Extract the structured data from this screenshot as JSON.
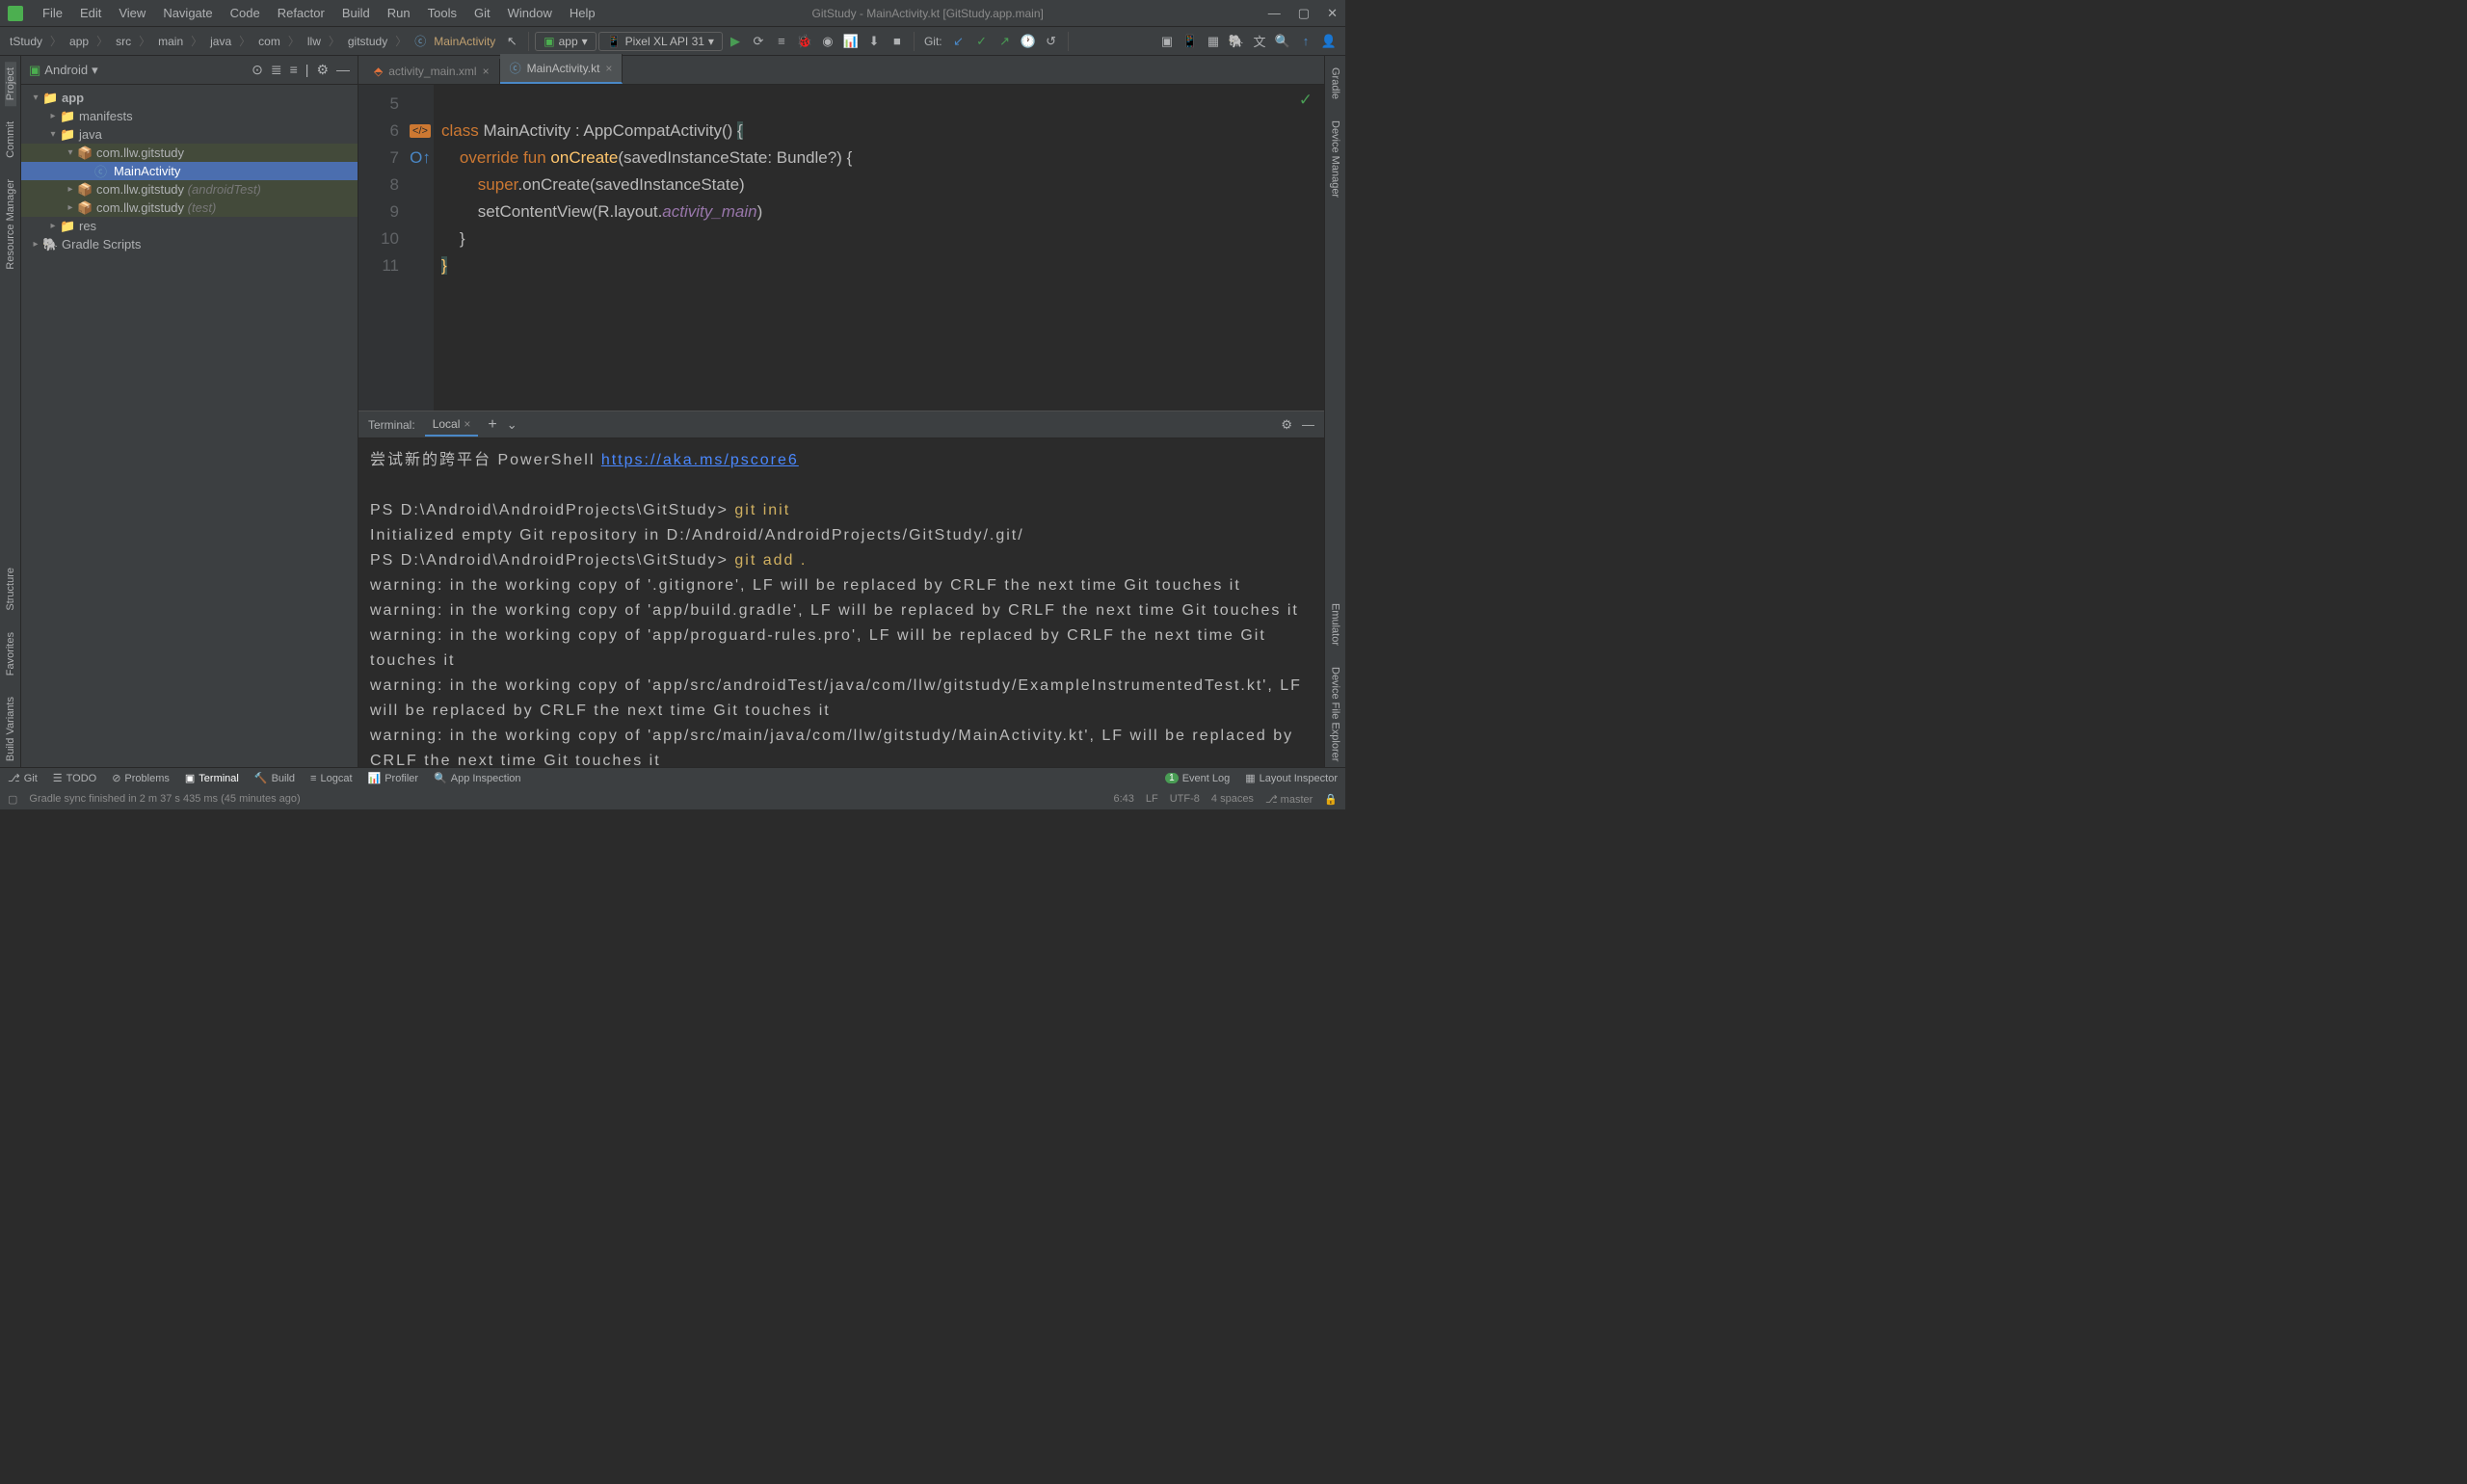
{
  "window": {
    "title": "GitStudy - MainActivity.kt [GitStudy.app.main]"
  },
  "menu": [
    "File",
    "Edit",
    "View",
    "Navigate",
    "Code",
    "Refactor",
    "Build",
    "Run",
    "Tools",
    "Git",
    "Window",
    "Help"
  ],
  "breadcrumb": [
    "tStudy",
    "app",
    "src",
    "main",
    "java",
    "com",
    "llw",
    "gitstudy"
  ],
  "breadcrumb_last": "MainActivity",
  "toolbar": {
    "config": "app",
    "device": "Pixel XL API 31",
    "git_label": "Git:"
  },
  "project": {
    "header": "Android",
    "tree": {
      "app": "app",
      "manifests": "manifests",
      "java": "java",
      "pkg_main": "com.llw.gitstudy",
      "main_activity": "MainActivity",
      "pkg_android_test": "com.llw.gitstudy",
      "pkg_android_test_suffix": "(androidTest)",
      "pkg_test": "com.llw.gitstudy",
      "pkg_test_suffix": "(test)",
      "res": "res",
      "gradle": "Gradle Scripts"
    }
  },
  "tabs": {
    "xml": "activity_main.xml",
    "kt": "MainActivity.kt"
  },
  "editor": {
    "line_numbers": [
      "5",
      "6",
      "7",
      "8",
      "9",
      "10",
      "11"
    ],
    "lines": [
      "",
      "class MainActivity : AppCompatActivity() {",
      "    override fun onCreate(savedInstanceState: Bundle?) {",
      "        super.onCreate(savedInstanceState)",
      "        setContentView(R.layout.activity_main)",
      "    }",
      "}"
    ]
  },
  "terminal": {
    "label": "Terminal:",
    "tab": "Local",
    "ps_hint": "尝试新的跨平台 PowerShell ",
    "ps_link": "https://aka.ms/pscore6",
    "prompt1": "PS D:\\Android\\AndroidProjects\\GitStudy> ",
    "cmd1": "git init",
    "out1": "Initialized empty Git repository in D:/Android/AndroidProjects/GitStudy/.git/",
    "prompt2": "PS D:\\Android\\AndroidProjects\\GitStudy> ",
    "cmd2": "git add .",
    "warn1": "warning: in the working copy of '.gitignore', LF will be replaced by CRLF the next time Git touches it",
    "warn2": "warning: in the working copy of 'app/build.gradle', LF will be replaced by CRLF the next time Git touches it",
    "warn3": "warning: in the working copy of 'app/proguard-rules.pro', LF will be replaced by CRLF the next time Git touches it",
    "warn4": "warning: in the working copy of 'app/src/androidTest/java/com/llw/gitstudy/ExampleInstrumentedTest.kt', LF will be replaced by CRLF the next time Git touches it",
    "warn5": "warning: in the working copy of 'app/src/main/java/com/llw/gitstudy/MainActivity.kt', LF will be replaced by CRLF the next time Git touches it"
  },
  "bottom_tabs": {
    "git": "Git",
    "todo": "TODO",
    "problems": "Problems",
    "terminal": "Terminal",
    "build": "Build",
    "logcat": "Logcat",
    "profiler": "Profiler",
    "app_inspection": "App Inspection",
    "event_log": "Event Log",
    "layout_inspector": "Layout Inspector"
  },
  "status": {
    "sync": "Gradle sync finished in 2 m 37 s 435 ms (45 minutes ago)",
    "pos": "6:43",
    "eol": "LF",
    "enc": "UTF-8",
    "indent": "4 spaces",
    "branch": "master"
  },
  "rails": {
    "left": [
      "Project",
      "Commit",
      "Resource Manager"
    ],
    "left2": [
      "Structure",
      "Favorites",
      "Build Variants"
    ],
    "right": [
      "Gradle",
      "Device Manager"
    ],
    "right2": [
      "Emulator",
      "Device File Explorer"
    ]
  }
}
